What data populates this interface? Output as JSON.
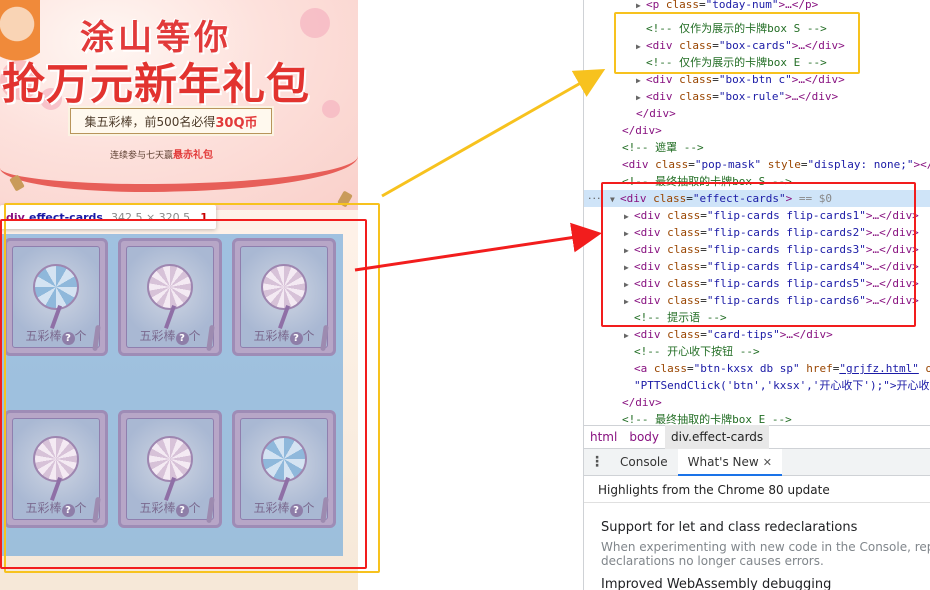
{
  "page": {
    "banner": {
      "title_line1": "涂山等你",
      "title_line2": "抢万元新年礼包",
      "reward_prefix": "集五彩棒，前500名必得",
      "reward_highlight": "30Q币",
      "sub_prefix": "连续参与七天赢",
      "sub_highlight": "悬赤礼包"
    },
    "inspect_tooltip": {
      "tag": "div",
      "class": ".effect-cards",
      "dimensions": "342.5 × 320.5",
      "number": "1"
    },
    "cards": [
      {
        "type": "bouquet",
        "label": "五彩棒",
        "q": "?",
        "suffix": "个"
      },
      {
        "type": "lollipop",
        "label": "五彩棒",
        "q": "?",
        "suffix": "个"
      },
      {
        "type": "lollipop",
        "label": "五彩棒",
        "q": "?",
        "suffix": "个"
      },
      {
        "type": "lollipop",
        "label": "五彩棒",
        "q": "?",
        "suffix": "个"
      },
      {
        "type": "lollipop",
        "label": "五彩棒",
        "q": "?",
        "suffix": "个"
      },
      {
        "type": "bouquet",
        "label": "五彩棒",
        "q": "?",
        "suffix": "个"
      }
    ]
  },
  "devtools": {
    "code": {
      "l0_tag_open": "<p",
      "l0_attr": "class",
      "l0_val": "\"today-num\"",
      "l0_rest": ">…</p>",
      "l1_comment": "<!-- 仅作为展示的卡牌box S -->",
      "l2_tag": "<div",
      "l2_attr": "class",
      "l2_val": "\"box-cards\"",
      "l2_rest": ">…</div>",
      "l3_comment": "<!-- 仅作为展示的卡牌box E -->",
      "l4_val": "\"box-btn c\"",
      "l5_val": "\"box-rule\"",
      "l6_close": "</div>",
      "l7_close": "</div>",
      "l8_comment": "<!-- 遮罩 -->",
      "l9_val": "\"pop-mask\"",
      "l9_attr2": "style",
      "l9_val2": "\"display: none;\"",
      "l9_rest": "></",
      "l10_comment": "<!-- 最终抽取的卡牌box S -->",
      "l11_val": "\"effect-cards\"",
      "l11_eq": "== $0",
      "flip_cards": [
        "\"flip-cards flip-cards1\"",
        "\"flip-cards flip-cards2\"",
        "\"flip-cards flip-cards3\"",
        "\"flip-cards flip-cards4\"",
        "\"flip-cards flip-cards5\"",
        "\"flip-cards flip-cards6\""
      ],
      "l18_comment": "<!-- 提示语 -->",
      "l19_val": "\"card-tips\"",
      "l20_comment": "<!-- 开心收下按钮 -->",
      "l21_tag": "<a",
      "l21_val": "\"btn-kxsx db sp\"",
      "l21_attr2": "href",
      "l21_href": "\"grjfz.html\"",
      "l21_rest": "o",
      "l22_text": "\"PTTSendClick('btn','kxsx','开心收下');\">开心收",
      "l23_close": "</div>",
      "l24_comment": "<!-- 最终抽取的卡牌box E -->"
    },
    "breadcrumb": [
      "html",
      "body",
      "div.effect-cards"
    ],
    "drawer": {
      "menu_icon": "⋮",
      "tabs": [
        "Console",
        "What's New"
      ],
      "close_icon": "✕"
    },
    "whats_new": {
      "header": "Highlights from the Chrome 80 update",
      "h1": "Support for let and class redeclarations",
      "p_line1": "When experimenting with new code in the Console, repea",
      "p_line2": "declarations no longer causes errors.",
      "h2": "Improved WebAssembly debugging"
    }
  },
  "colors": {
    "highlight_overlay": "#6fa8dc",
    "annotation_yellow": "#f7c21e",
    "annotation_red": "#f21d1d",
    "selected_row": "#cfe4f8",
    "title_red": "#e23a3a"
  }
}
